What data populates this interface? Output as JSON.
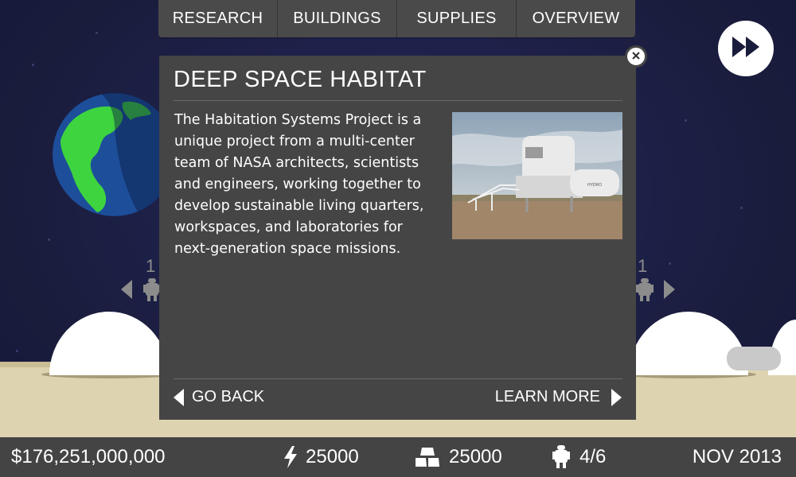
{
  "nav": {
    "tabs": [
      {
        "label": "RESEARCH"
      },
      {
        "label": "BUILDINGS"
      },
      {
        "label": "SUPPLIES"
      },
      {
        "label": "OVERVIEW"
      }
    ]
  },
  "controls": {
    "fast_forward_icon": "fast-forward-icon",
    "close_icon": "close-icon"
  },
  "left_module": {
    "count": "1"
  },
  "right_module": {
    "count": "1"
  },
  "panel": {
    "title": "DEEP SPACE HABITAT",
    "body": "The Habitation Systems Project is a unique project from a multi-center team of NASA architects, scientists and engineers, working together to develop sustainable living quarters, workspaces, and laboratories for next-generation space missions.",
    "photo_sign": "HYDRO",
    "go_back_label": "GO BACK",
    "learn_more_label": "LEARN MORE"
  },
  "status": {
    "money": "$176,251,000,000",
    "energy": "25000",
    "materials": "25000",
    "crew": "4/6",
    "date": "NOV 2013"
  },
  "colors": {
    "space": "#1b1e3f",
    "panel": "#454545",
    "status_bar": "#444444",
    "ground": "#ddd3b0",
    "earth_ocean": "#1d4e9a",
    "earth_land": "#3ed43f"
  }
}
